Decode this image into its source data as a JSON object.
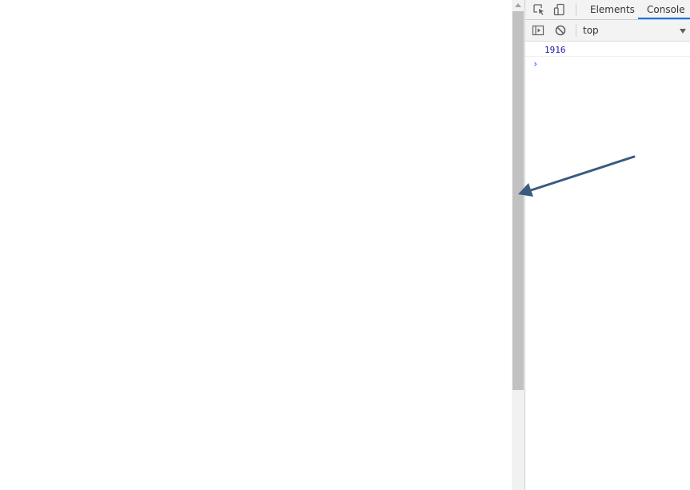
{
  "devtools": {
    "tabs": [
      {
        "label": "Elements",
        "active": false
      },
      {
        "label": "Console",
        "active": true
      }
    ],
    "icons": {
      "inspect": "inspect-element-icon",
      "device": "device-toolbar-icon",
      "sidebar": "show-console-sidebar-icon",
      "clear": "clear-console-icon"
    },
    "context": {
      "selected": "top"
    },
    "console": {
      "output": [
        "1916"
      ],
      "prompt_symbol": "›"
    }
  },
  "colors": {
    "accent": "#1a73e8",
    "console_number": "#1a1aa6",
    "prompt": "#367cf1",
    "arrow": "#3a5a80"
  }
}
